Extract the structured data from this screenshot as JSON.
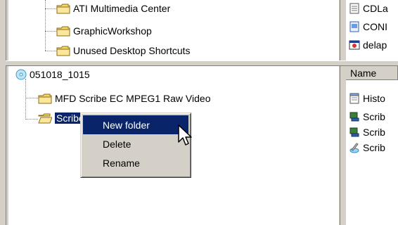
{
  "top_tree": {
    "items": [
      {
        "label": "ATI Multimedia Center",
        "icon": "folder-icon"
      },
      {
        "label": "GraphicWorkshop",
        "icon": "folder-icon"
      },
      {
        "label": "Unused Desktop Shortcuts",
        "icon": "folder-icon"
      }
    ]
  },
  "top_list": {
    "items": [
      {
        "label": "CDLa",
        "icon": "text-file-icon"
      },
      {
        "label": "CONI",
        "icon": "config-file-icon"
      },
      {
        "label": "delap",
        "icon": "application-icon"
      }
    ]
  },
  "bottom_tree": {
    "root": {
      "label": "051018_1015",
      "icon": "cd-drive-icon"
    },
    "items": [
      {
        "label": "MFD Scribe EC MPEG1 Raw Video",
        "icon": "folder-icon"
      },
      {
        "label": "Scribe EC",
        "icon": "folder-open-icon",
        "selected": true
      }
    ]
  },
  "bottom_list": {
    "header": {
      "name": "Name"
    },
    "items": [
      {
        "label": "Histo",
        "icon": "notepad-icon"
      },
      {
        "label": "Scrib",
        "icon": "computer-icon"
      },
      {
        "label": "Scrib",
        "icon": "computer-icon"
      },
      {
        "label": "Scrib",
        "icon": "cd-shortcut-icon"
      }
    ]
  },
  "context_menu": {
    "items": [
      {
        "label": "New folder",
        "highlighted": true
      },
      {
        "label": "Delete"
      },
      {
        "label": "Rename"
      }
    ]
  },
  "colors": {
    "selection": "#0a246a",
    "window_face": "#d4d0c8",
    "folder_yellow": "#f6d56b"
  }
}
